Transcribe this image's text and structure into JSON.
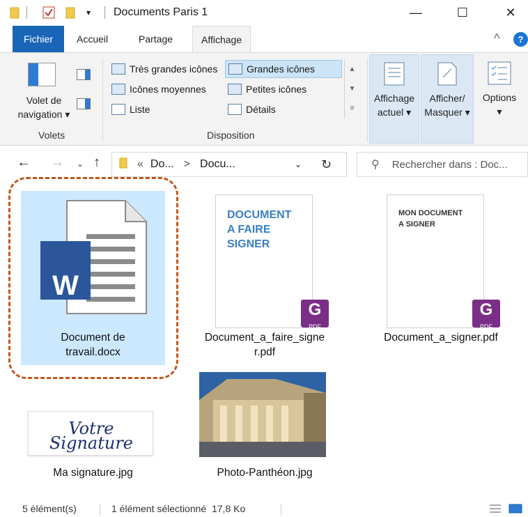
{
  "window": {
    "title": "Documents Paris 1",
    "minimize": "—",
    "maximize": "☐",
    "close": "✕"
  },
  "ribbon_tabs": [
    {
      "label": "Fichier"
    },
    {
      "label": "Accueil"
    },
    {
      "label": "Partage"
    },
    {
      "label": "Affichage"
    }
  ],
  "ribbon": {
    "help": "?",
    "collapse": "^",
    "panes": {
      "nav_pane_label_line1": "Volet de",
      "nav_pane_label_line2": "navigation",
      "group_label": "Volets"
    },
    "layout": {
      "items": [
        {
          "label": "Très grandes icônes"
        },
        {
          "label": "Grandes icônes"
        },
        {
          "label": "Icônes moyennes"
        },
        {
          "label": "Petites icônes"
        },
        {
          "label": "Liste"
        },
        {
          "label": "Détails"
        }
      ],
      "group_label": "Disposition"
    },
    "current_view_line1": "Affichage",
    "current_view_line2": "actuel",
    "show_hide_line1": "Afficher/",
    "show_hide_line2": "Masquer",
    "options": "Options"
  },
  "address": {
    "overflow": "«",
    "crumb1": "Do...",
    "sep": ">",
    "crumb2": "Docu...",
    "search_placeholder": "Rechercher dans : Doc..."
  },
  "files": [
    {
      "name_line1": "Document de",
      "name_line2": "travail.docx",
      "word_letter": "W"
    },
    {
      "name_line1": "Document_a_faire_signe",
      "name_line2": "r.pdf",
      "thumb_lines": [
        "DOCUMENT",
        "A FAIRE",
        "SIGNER"
      ],
      "badge": "PDF"
    },
    {
      "name_line1": "Document_a_signer.pdf",
      "thumb_lines": [
        "MON DOCUMENT",
        "A SIGNER"
      ],
      "badge": "PDF"
    },
    {
      "name_line1": "Ma signature.jpg",
      "signature_text": "Votre Signature"
    },
    {
      "name_line1": "Photo-Panthéon.jpg"
    }
  ],
  "status": {
    "count": "5 élément(s)",
    "selected": "1 élément sélectionné  17,8 Ko"
  },
  "colors": {
    "file_tab": "#1966b8",
    "selection": "#cce8ff",
    "highlight_ring": "#c0561b",
    "word_blue": "#2b579a",
    "foxit_purple": "#7a2f86",
    "pdf_title_blue": "#3b7fc4"
  }
}
